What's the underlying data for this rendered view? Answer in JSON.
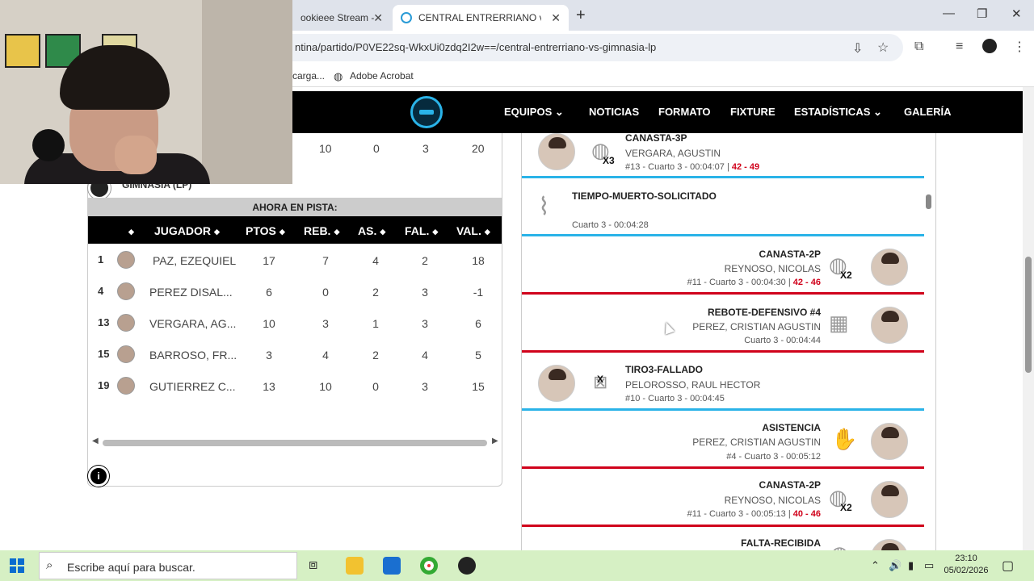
{
  "browser": {
    "tabs": [
      {
        "title": "ookieee Stream -"
      },
      {
        "title": "CENTRAL ENTRERRIANO vs GIMNASIA LP"
      }
    ],
    "url": "ntina/partido/P0VE22sq-WkxUi0zdq2I2w==/central-entrerriano-vs-gimnasia-lp",
    "bookmarks": [
      "carga...",
      "Adobe Acrobat"
    ]
  },
  "site_nav": {
    "items": [
      "EQUIPOS",
      "NOTICIAS",
      "FORMATO",
      "FIXTURE",
      "ESTADÍSTICAS",
      "GALERÍA"
    ]
  },
  "box_score": {
    "previous_totals": [
      "10",
      "0",
      "3",
      "20"
    ],
    "team_name": "GIMNASIA (LP)",
    "on_floor_label": "AHORA EN PISTA:",
    "columns": [
      "JUGADOR",
      "PTOS",
      "REB.",
      "AS.",
      "FAL.",
      "VAL."
    ],
    "rows": [
      {
        "num": "1",
        "name": "PAZ, EZEQUIEL",
        "pts": "17",
        "reb": "7",
        "as": "4",
        "fal": "2",
        "val": "18"
      },
      {
        "num": "4",
        "name": "PEREZ DISAL...",
        "pts": "6",
        "reb": "0",
        "as": "2",
        "fal": "3",
        "val": "-1"
      },
      {
        "num": "13",
        "name": "VERGARA, AG...",
        "pts": "10",
        "reb": "3",
        "as": "1",
        "fal": "3",
        "val": "6"
      },
      {
        "num": "15",
        "name": "BARROSO, FR...",
        "pts": "3",
        "reb": "4",
        "as": "2",
        "fal": "4",
        "val": "5"
      },
      {
        "num": "19",
        "name": "GUTIERREZ C...",
        "pts": "13",
        "reb": "10",
        "as": "0",
        "fal": "3",
        "val": "15"
      }
    ],
    "info_label": "i"
  },
  "feed": [
    {
      "title": "CANASTA-3P",
      "player": "VERGARA, AGUSTIN",
      "meta": "#13 - Cuarto 3 - 00:04:07 | ",
      "score": "42 - 49",
      "mult": "X3",
      "side": "left"
    },
    {
      "title": "TIEMPO-MUERTO-SOLICITADO",
      "meta": "Cuarto 3 - 00:04:28",
      "side": "timeout"
    },
    {
      "title": "CANASTA-2P",
      "player": "REYNOSO, NICOLAS",
      "meta": "#11 - Cuarto 3 - 00:04:30 | ",
      "score": "42 - 46",
      "mult": "X2",
      "side": "right"
    },
    {
      "title": "REBOTE-DEFENSIVO #4",
      "player": "PEREZ, CRISTIAN AGUSTIN",
      "meta": "Cuarto 3 - 00:04:44",
      "side": "right"
    },
    {
      "title": "TIRO3-FALLADO",
      "player": "PELOROSSO, RAUL HECTOR",
      "meta": "#10 - Cuarto 3 - 00:04:45",
      "mult": "X",
      "side": "left"
    },
    {
      "title": "ASISTENCIA",
      "player": "PEREZ, CRISTIAN AGUSTIN",
      "meta": "#4 - Cuarto 3 - 00:05:12",
      "side": "right"
    },
    {
      "title": "CANASTA-2P",
      "player": "REYNOSO, NICOLAS",
      "meta": "#11 - Cuarto 3 - 00:05:13 | ",
      "score": "40 - 46",
      "mult": "X2",
      "side": "right"
    },
    {
      "title": "FALTA-RECIBIDA",
      "side": "right"
    }
  ],
  "taskbar": {
    "search_placeholder": "Escribe aquí para buscar.",
    "time": "23:10",
    "date": "05/02/2026"
  },
  "colors": {
    "accent_blue": "#2ab3e8",
    "accent_red": "#d0021b",
    "nav_bg": "#000000"
  }
}
